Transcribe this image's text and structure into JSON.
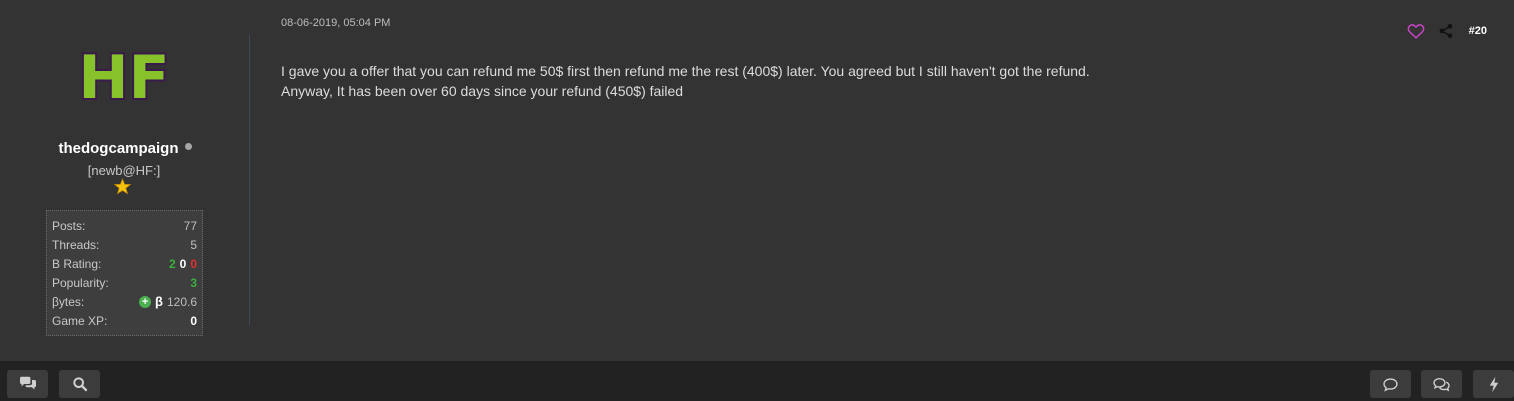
{
  "post": {
    "date": "08-06-2019, 05:04 PM",
    "number": "#20",
    "body_lines": [
      "I gave you a offer that you can refund me 50$ first then refund me the rest (400$) later. You agreed but I still haven't got the refund.",
      "Anyway, It has been over 60 days since your refund (450$) failed"
    ]
  },
  "author": {
    "avatar_text": "HF",
    "username": "thedogcampaign",
    "usertitle": "[newb@HF:]",
    "stats": {
      "posts_label": "Posts:",
      "posts_value": "77",
      "threads_label": "Threads:",
      "threads_value": "5",
      "rating_label": "B Rating:",
      "rating_positive": "2",
      "rating_neutral": "0",
      "rating_negative": "0",
      "popularity_label": "Popularity:",
      "popularity_value": "3",
      "bytes_label": "βytes:",
      "bytes_symbol": "β",
      "bytes_value": "120.6",
      "gamexp_label": "Game XP:",
      "gamexp_value": "0"
    }
  },
  "icons": {
    "like": "heart-icon",
    "share": "share-icon",
    "chat": "chat-bubbles-icon",
    "search": "search-icon",
    "comment": "comment-icon",
    "conversations": "conversations-icon",
    "activity": "lightning-icon"
  },
  "colors": {
    "background": "#333333",
    "bottom_bar": "#222222",
    "heart": "#cc44cc",
    "positive": "#3cb03c",
    "negative": "#e03030"
  }
}
